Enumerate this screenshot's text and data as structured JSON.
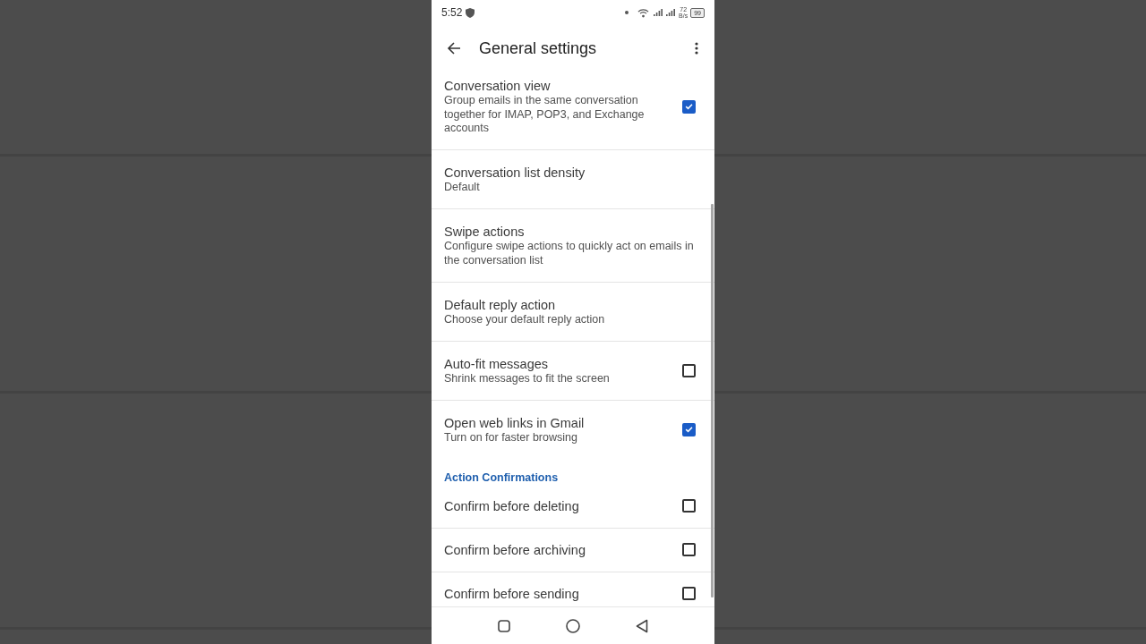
{
  "status_bar": {
    "time": "5:52",
    "net_speed": "72",
    "net_speed_unit": "B/s",
    "battery": "99"
  },
  "app_bar": {
    "title": "General settings"
  },
  "settings": [
    {
      "kind": "checkbox",
      "title": "Conversation view",
      "subtitle": "Group emails in the same conversation together for IMAP, POP3, and Exchange accounts",
      "checked": true
    },
    {
      "kind": "option",
      "title": "Conversation list density",
      "subtitle": "Default"
    },
    {
      "kind": "option",
      "title": "Swipe actions",
      "subtitle": "Configure swipe actions to quickly act on emails in the conversation list"
    },
    {
      "kind": "option",
      "title": "Default reply action",
      "subtitle": "Choose your default reply action"
    },
    {
      "kind": "checkbox",
      "title": "Auto-fit messages",
      "subtitle": "Shrink messages to fit the screen",
      "checked": false
    },
    {
      "kind": "checkbox",
      "title": "Open web links in Gmail",
      "subtitle": "Turn on for faster browsing",
      "checked": true
    },
    {
      "kind": "section",
      "title": "Action Confirmations"
    },
    {
      "kind": "checkbox",
      "title": "Confirm before deleting",
      "checked": false
    },
    {
      "kind": "checkbox",
      "title": "Confirm before archiving",
      "checked": false
    },
    {
      "kind": "checkbox",
      "title": "Confirm before sending",
      "checked": false
    }
  ]
}
